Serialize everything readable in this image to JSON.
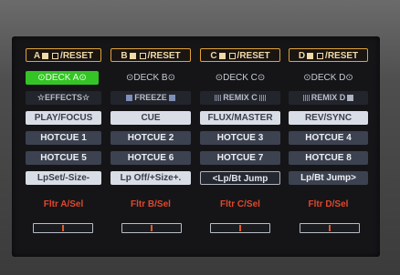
{
  "reset_buttons": [
    {
      "letter": "A",
      "label": "/RESET"
    },
    {
      "letter": "B",
      "label": "/RESET"
    },
    {
      "letter": "C",
      "label": "/RESET"
    },
    {
      "letter": "D",
      "label": "/RESET"
    }
  ],
  "deck_buttons": [
    "DECK A",
    "DECK B",
    "DECK C",
    "DECK D"
  ],
  "toggle_buttons": [
    "EFFECTS",
    "FREEZE",
    "REMIX C",
    "REMIX D"
  ],
  "mode_buttons": [
    "PLAY/FOCUS",
    "CUE",
    "FLUX/MASTER",
    "REV/SYNC"
  ],
  "hotcues_row1": [
    "HOTCUE 1",
    "HOTCUE 2",
    "HOTCUE 3",
    "HOTCUE 4"
  ],
  "hotcues_row2": [
    "HOTCUE 5",
    "HOTCUE 6",
    "HOTCUE 7",
    "HOTCUE 8"
  ],
  "loop_buttons": [
    "LpSet/-Size-",
    "Lp Off/+Size+.",
    "<Lp/Bt Jump",
    "Lp/Bt Jump>"
  ],
  "filter_labels": [
    "Fltr A/Sel",
    "Fltr B/Sel",
    "Fltr C/Sel",
    "Fltr D/Sel"
  ],
  "filter_values": [
    0.5,
    0.5,
    0.5,
    0.5
  ],
  "colors": {
    "accent_orange": "#e0a23a",
    "active_green": "#35c425",
    "filter_red": "#e0482c"
  }
}
